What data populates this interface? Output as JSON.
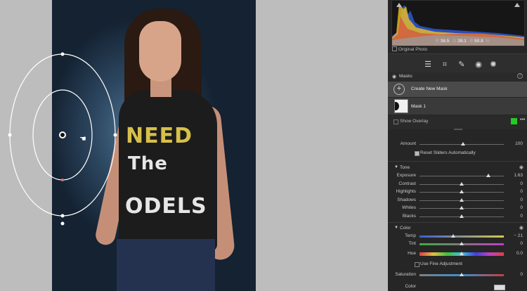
{
  "histogram": {
    "readout_r_label": "R",
    "readout_r": "36.5",
    "readout_g_label": "G",
    "readout_g": "39.1",
    "readout_b_label": "B",
    "readout_b": "50.8",
    "readout_unit": "%",
    "original_photo_label": "Original Photo"
  },
  "toolbar": {
    "icons": [
      "edit-sliders-icon",
      "crop-icon",
      "healing-icon",
      "redeye-icon",
      "masking-icon"
    ],
    "active": "masking-icon"
  },
  "masks": {
    "header_label": "Masks",
    "create_label": "Create New Mask",
    "mask_name": "Mask 1",
    "show_overlay_label": "Show Overlay",
    "overlay_color": "#22cc22"
  },
  "amount": {
    "label": "Amount",
    "value": "100",
    "level": 1.0
  },
  "reset_sliders_label": "Reset Sliders Automatically",
  "tone": {
    "section_label": "Tone",
    "sliders": [
      {
        "label": "Exposure",
        "value": "1.63",
        "level": 0.82
      },
      {
        "label": "Contrast",
        "value": "0",
        "level": 0.5
      },
      {
        "label": "Highlights",
        "value": "0",
        "level": 0.5
      },
      {
        "label": "Shadows",
        "value": "0",
        "level": 0.5
      },
      {
        "label": "Whites",
        "value": "0",
        "level": 0.5
      },
      {
        "label": "Blacks",
        "value": "0",
        "level": 0.5
      }
    ]
  },
  "color": {
    "section_label": "Color",
    "temp": {
      "label": "Temp",
      "value": "− 21",
      "level": 0.4
    },
    "tint": {
      "label": "Tint",
      "value": "0",
      "level": 0.5
    },
    "hue": {
      "label": "Hue",
      "value": "0.0",
      "level": 0.5
    },
    "fine_adjust_label": "Use Fine Adjustment",
    "saturation": {
      "label": "Saturation",
      "value": "0",
      "level": 0.5
    },
    "color_label": "Color"
  },
  "colors": {
    "panel_bg": "#262626",
    "selected_row": "#4a4a4a",
    "mask_outline": "#ffffff",
    "mask_pin": "#111111"
  }
}
